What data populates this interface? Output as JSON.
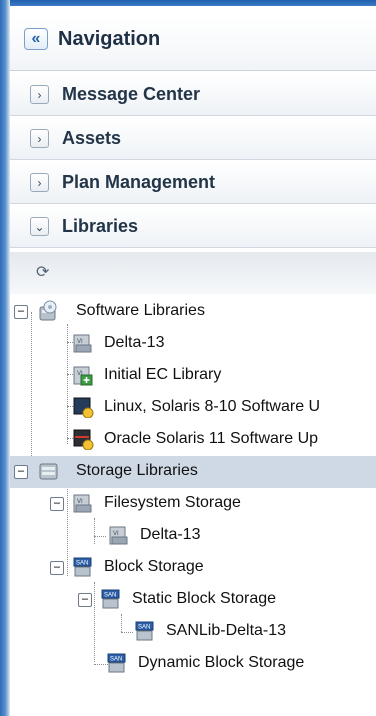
{
  "navigation": {
    "title": "Navigation",
    "collapse_icon": "double-chevron-left-icon"
  },
  "accordion": [
    {
      "label": "Message Center",
      "state": "collapsed"
    },
    {
      "label": "Assets",
      "state": "collapsed"
    },
    {
      "label": "Plan Management",
      "state": "collapsed"
    },
    {
      "label": "Libraries",
      "state": "expanded"
    }
  ],
  "toolbar": {
    "refresh_icon": "refresh-icon"
  },
  "tree": {
    "software_libraries": {
      "label": "Software Libraries",
      "children": [
        {
          "label": "Delta-13"
        },
        {
          "label": "Initial EC Library"
        },
        {
          "label": "Linux, Solaris 8-10 Software U"
        },
        {
          "label": "Oracle Solaris 11 Software Up"
        }
      ]
    },
    "storage_libraries": {
      "label": "Storage Libraries",
      "selected": true,
      "filesystem": {
        "label": "Filesystem Storage",
        "children": [
          {
            "label": "Delta-13"
          }
        ]
      },
      "block": {
        "label": "Block Storage",
        "static": {
          "label": "Static Block Storage",
          "children": [
            {
              "label": "SANLib-Delta-13"
            }
          ]
        },
        "dynamic": {
          "label": "Dynamic Block Storage"
        }
      }
    }
  },
  "colors": {
    "selection": "#cfd8e5",
    "accent": "#2f6bb6"
  }
}
